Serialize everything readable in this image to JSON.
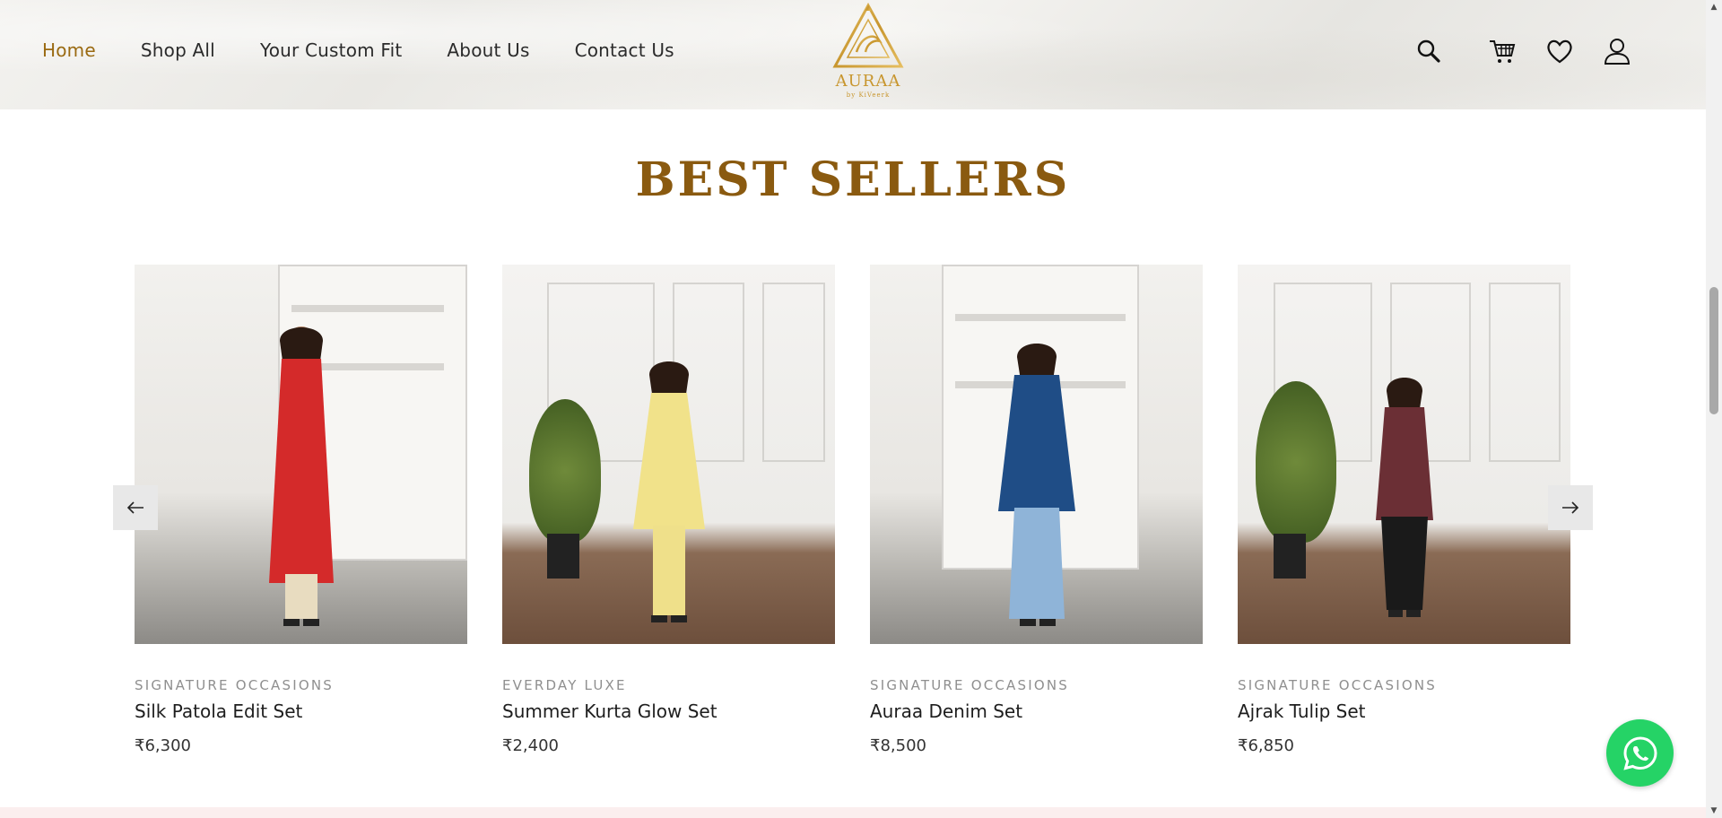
{
  "header": {
    "nav": [
      {
        "label": "Home",
        "active": true
      },
      {
        "label": "Shop All",
        "active": false
      },
      {
        "label": "Your Custom Fit",
        "active": false
      },
      {
        "label": "About Us",
        "active": false
      },
      {
        "label": "Contact Us",
        "active": false
      }
    ],
    "logo": {
      "text": "AURAA",
      "subtext": "by KiVeerk"
    },
    "icons": [
      "search-icon",
      "cart-icon",
      "wishlist-heart-icon",
      "account-user-icon"
    ]
  },
  "section": {
    "title": "BEST SELLERS"
  },
  "products": [
    {
      "category": "SIGNATURE OCCASIONS",
      "name": "Silk Patola Edit Set",
      "price": "₹6,300",
      "top_color": "#d42a2a",
      "bottom_color": "#e8dcc0"
    },
    {
      "category": "EVERDAY LUXE",
      "name": "Summer Kurta Glow Set",
      "price": "₹2,400",
      "top_color": "#f1e28a",
      "bottom_color": "#efe08a"
    },
    {
      "category": "SIGNATURE OCCASIONS",
      "name": "Auraa Denim Set",
      "price": "₹8,500",
      "top_color": "#1f4d86",
      "bottom_color": "#8fb4d8"
    },
    {
      "category": "SIGNATURE OCCASIONS",
      "name": "Ajrak Tulip Set",
      "price": "₹6,850",
      "top_color": "#6b2f35",
      "bottom_color": "#1a1a1a"
    }
  ],
  "carousel": {
    "prev_icon": "arrow-left-icon",
    "next_icon": "arrow-right-icon"
  },
  "colors": {
    "accent": "#9a6a12",
    "title": "#8a5a10",
    "whatsapp": "#25d366"
  }
}
